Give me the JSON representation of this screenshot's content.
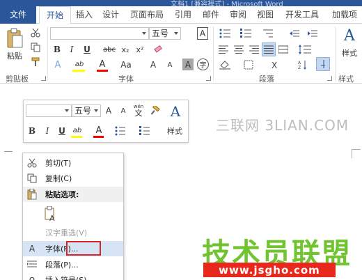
{
  "window": {
    "title": "文档1 [兼容模式] - Microsoft Word"
  },
  "tabs": [
    "文件",
    "开始",
    "插入",
    "设计",
    "页面布局",
    "引用",
    "邮件",
    "审阅",
    "视图",
    "开发工具",
    "加载项"
  ],
  "ribbon": {
    "clipboard": {
      "label": "剪贴板",
      "paste_label": "粘贴"
    },
    "font": {
      "label": "字体",
      "font_name_value": "",
      "font_size_value": "五号",
      "bold": "B",
      "italic": "I",
      "underline": "U",
      "strike": "abc",
      "subscript": "x₂",
      "superscript": "x²",
      "text_effect": "A",
      "highlight": "ab",
      "font_color": "A",
      "case": "Aa",
      "grow": "A",
      "shrink": "A",
      "char_shade": "A",
      "enclose": "字",
      "box_glyph": "A"
    },
    "paragraph": {
      "label": "段落"
    },
    "styles": {
      "label": "样式",
      "styles_label": "样式",
      "glyph": "A"
    }
  },
  "mini_toolbar": {
    "font_name_value": "",
    "font_size_value": "五号",
    "wen": "wén",
    "wen_char": "文",
    "bold": "B",
    "italic": "I",
    "underline": "U",
    "highlight": "ab",
    "font_color": "A",
    "styles_label": "样式",
    "styles_glyph": "A"
  },
  "watermark": "三联网 3LIAN.COM",
  "context_menu": {
    "items": [
      {
        "label": "剪切(T)",
        "icon": "scissors-icon",
        "state": "normal"
      },
      {
        "label": "复制(C)",
        "icon": "copy-icon",
        "state": "normal"
      },
      {
        "label": "粘贴选项:",
        "icon": "paste-icon",
        "state": "section"
      },
      {
        "label": "",
        "icon": "paste-keep-text-icon",
        "state": "normal"
      },
      {
        "label": "汉字重选(V)",
        "icon": "",
        "state": "disabled"
      },
      {
        "label": "字体(F)...",
        "icon": "font-icon",
        "state": "highlighted"
      },
      {
        "label": "段落(P)...",
        "icon": "paragraph-icon",
        "state": "normal"
      },
      {
        "label": "插入符号(S)",
        "icon": "symbol-icon",
        "state": "normal"
      }
    ]
  },
  "brand": {
    "name": "技术员联盟",
    "url": "www.jsgho.com"
  },
  "colors": {
    "accent": "#2b579a",
    "highlight_yellow": "#ffff00",
    "font_red": "#ff0000",
    "menu_highlight": "#d6e4f4",
    "callout_red": "#d9242b",
    "brand_green": "#6fc42f"
  }
}
